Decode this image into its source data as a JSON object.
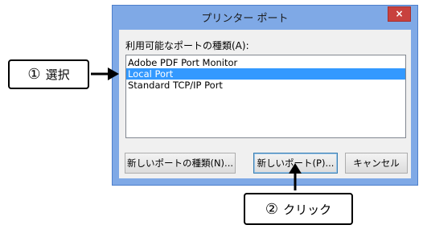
{
  "dialog": {
    "title": "プリンター ポート",
    "close_label": "×",
    "list_label": "利用可能なポートの種類(A):",
    "ports": [
      {
        "label": "Adobe PDF Port Monitor",
        "selected": false
      },
      {
        "label": "Local Port",
        "selected": true
      },
      {
        "label": "Standard TCP/IP Port",
        "selected": false
      }
    ],
    "buttons": {
      "new_port_type": "新しいポートの種類(N)...",
      "new_port": "新しいポート(P)...",
      "cancel": "キャンセル"
    }
  },
  "callouts": {
    "step1": {
      "number": "①",
      "text": "選択"
    },
    "step2": {
      "number": "②",
      "text": "クリック"
    }
  },
  "colors": {
    "title_bar": "#7fa9e6",
    "selection": "#3399ff",
    "close_button": "#c8413e"
  }
}
